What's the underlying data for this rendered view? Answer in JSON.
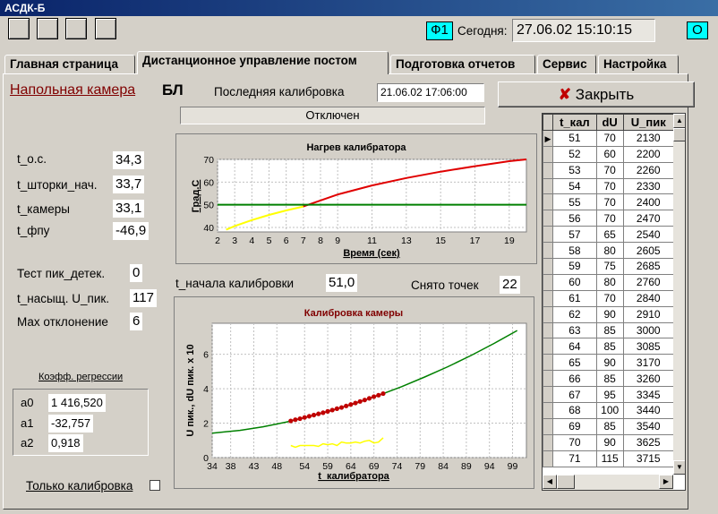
{
  "window": {
    "title": "АСДК-Б"
  },
  "header": {
    "f1_label": "Ф1",
    "today_label": "Сегодня:",
    "datetime": "27.06.02 15:10:15",
    "o_label": "О"
  },
  "tabs": [
    {
      "label": "Главная страница"
    },
    {
      "label": "Дистанционное управление постом"
    },
    {
      "label": "Подготовка отчетов"
    },
    {
      "label": "Сервис"
    },
    {
      "label": "Настройка"
    }
  ],
  "camera": {
    "name": "Напольная камера",
    "code": "БЛ",
    "last_calib_label": "Последняя калибровка",
    "last_calib_value": "21.06.02  17:06:00",
    "status": "Отключен"
  },
  "close_button": {
    "label": "Закрыть"
  },
  "params": [
    {
      "label": "t_о.с.",
      "value": "34,3"
    },
    {
      "label": "t_шторки_нач.",
      "value": "33,7"
    },
    {
      "label": "t_камеры",
      "value": "33,1"
    },
    {
      "label": "t_фпу",
      "value": "-46,9"
    }
  ],
  "tests": [
    {
      "label": "Тест пик_детек.",
      "value": "0"
    },
    {
      "label": "t_насыщ. U_пик.",
      "value": "117"
    },
    {
      "label": "Мах отклонение",
      "value": "6"
    }
  ],
  "regression": {
    "title": "Коэфф. регрессии",
    "coeffs": [
      {
        "label": "a0",
        "value": "1 416,520"
      },
      {
        "label": "a1",
        "value": "-32,757"
      },
      {
        "label": "a2",
        "value": "0,918"
      }
    ]
  },
  "calib_start": {
    "label": "t_начала калибровки",
    "value": "51,0"
  },
  "points_taken": {
    "label": "Снято точек",
    "value": "22"
  },
  "only_calibration": {
    "label": "Только калибровка",
    "checked": false
  },
  "table": {
    "columns": [
      "t_кал",
      "dU",
      "U_пик"
    ],
    "rows": [
      [
        "51",
        "70",
        "2130"
      ],
      [
        "52",
        "60",
        "2200"
      ],
      [
        "53",
        "70",
        "2260"
      ],
      [
        "54",
        "70",
        "2330"
      ],
      [
        "55",
        "70",
        "2400"
      ],
      [
        "56",
        "70",
        "2470"
      ],
      [
        "57",
        "65",
        "2540"
      ],
      [
        "58",
        "80",
        "2605"
      ],
      [
        "59",
        "75",
        "2685"
      ],
      [
        "60",
        "80",
        "2760"
      ],
      [
        "61",
        "70",
        "2840"
      ],
      [
        "62",
        "90",
        "2910"
      ],
      [
        "63",
        "85",
        "3000"
      ],
      [
        "64",
        "85",
        "3085"
      ],
      [
        "65",
        "90",
        "3170"
      ],
      [
        "66",
        "85",
        "3260"
      ],
      [
        "67",
        "95",
        "3345"
      ],
      [
        "68",
        "100",
        "3440"
      ],
      [
        "69",
        "85",
        "3540"
      ],
      [
        "70",
        "90",
        "3625"
      ],
      [
        "71",
        "115",
        "3715"
      ]
    ]
  },
  "chart_data": [
    {
      "type": "line",
      "title": "Нагрев калибратора",
      "xlabel": "Время (сек)",
      "ylabel": "Град.С",
      "xlim": [
        2,
        20
      ],
      "ylim": [
        38,
        70
      ],
      "xticks": [
        "2",
        "3",
        "4",
        "5",
        "6",
        "7",
        "8",
        "9",
        "11",
        "13",
        "15",
        "17",
        "19"
      ],
      "yticks": [
        "40",
        "50",
        "60",
        "70"
      ],
      "grid": true,
      "colors": {
        "yellow": "#ffff00",
        "red": "#e00000",
        "green": "#008000"
      },
      "series": [
        {
          "color": "#ffff00",
          "x": [
            2.5,
            3,
            4,
            5,
            6,
            7
          ],
          "y": [
            39,
            40.6,
            43.2,
            45.5,
            47.5,
            49.2
          ]
        },
        {
          "color": "#e00000",
          "x": [
            7,
            9,
            11,
            13,
            15,
            17,
            19,
            20
          ],
          "y": [
            49.2,
            54.5,
            58.5,
            61.8,
            64.6,
            67,
            69.2,
            70
          ]
        },
        {
          "color": "#008000",
          "x": [
            2,
            20
          ],
          "y": [
            50,
            50
          ]
        }
      ]
    },
    {
      "type": "line",
      "title": "Калибровка камеры",
      "xlabel": "t_калибратора",
      "ylabel": "U пик., dU пик. х 10",
      "xlim": [
        34,
        102
      ],
      "ylim": [
        0,
        7.8
      ],
      "xticks": [
        "34",
        "38",
        "43",
        "48",
        "54",
        "59",
        "64",
        "69",
        "74",
        "79",
        "84",
        "89",
        "94",
        "99"
      ],
      "yticks": [
        "0",
        "2",
        "4",
        "6"
      ],
      "grid": true,
      "colors": {
        "green": "#008000",
        "red": "#c00000",
        "yellow": "#ffff00"
      },
      "series": [
        {
          "color": "#008000",
          "x": [
            34,
            40,
            45,
            50,
            55,
            60,
            65,
            70,
            75,
            80,
            85,
            90,
            95,
            100
          ],
          "y": [
            1.42,
            1.58,
            1.79,
            2.06,
            2.38,
            2.74,
            3.15,
            3.61,
            4.12,
            4.68,
            5.28,
            5.93,
            6.63,
            7.38
          ]
        },
        {
          "color": "#c00000",
          "x": [
            51,
            52,
            53,
            54,
            55,
            56,
            57,
            58,
            59,
            60,
            61,
            62,
            63,
            64,
            65,
            66,
            67,
            68,
            69,
            70,
            71
          ],
          "y": [
            2.13,
            2.2,
            2.26,
            2.33,
            2.4,
            2.47,
            2.54,
            2.605,
            2.685,
            2.76,
            2.84,
            2.91,
            3.0,
            3.085,
            3.17,
            3.26,
            3.345,
            3.44,
            3.54,
            3.625,
            3.715
          ]
        },
        {
          "color": "#ffff00",
          "x": [
            51,
            52,
            53,
            54,
            55,
            56,
            57,
            58,
            59,
            60,
            61,
            62,
            63,
            64,
            65,
            66,
            67,
            68,
            69,
            70,
            71
          ],
          "y": [
            0.7,
            0.6,
            0.7,
            0.7,
            0.7,
            0.7,
            0.65,
            0.8,
            0.75,
            0.8,
            0.7,
            0.9,
            0.85,
            0.85,
            0.9,
            0.85,
            0.95,
            1.0,
            0.85,
            0.9,
            1.15
          ]
        }
      ]
    }
  ]
}
